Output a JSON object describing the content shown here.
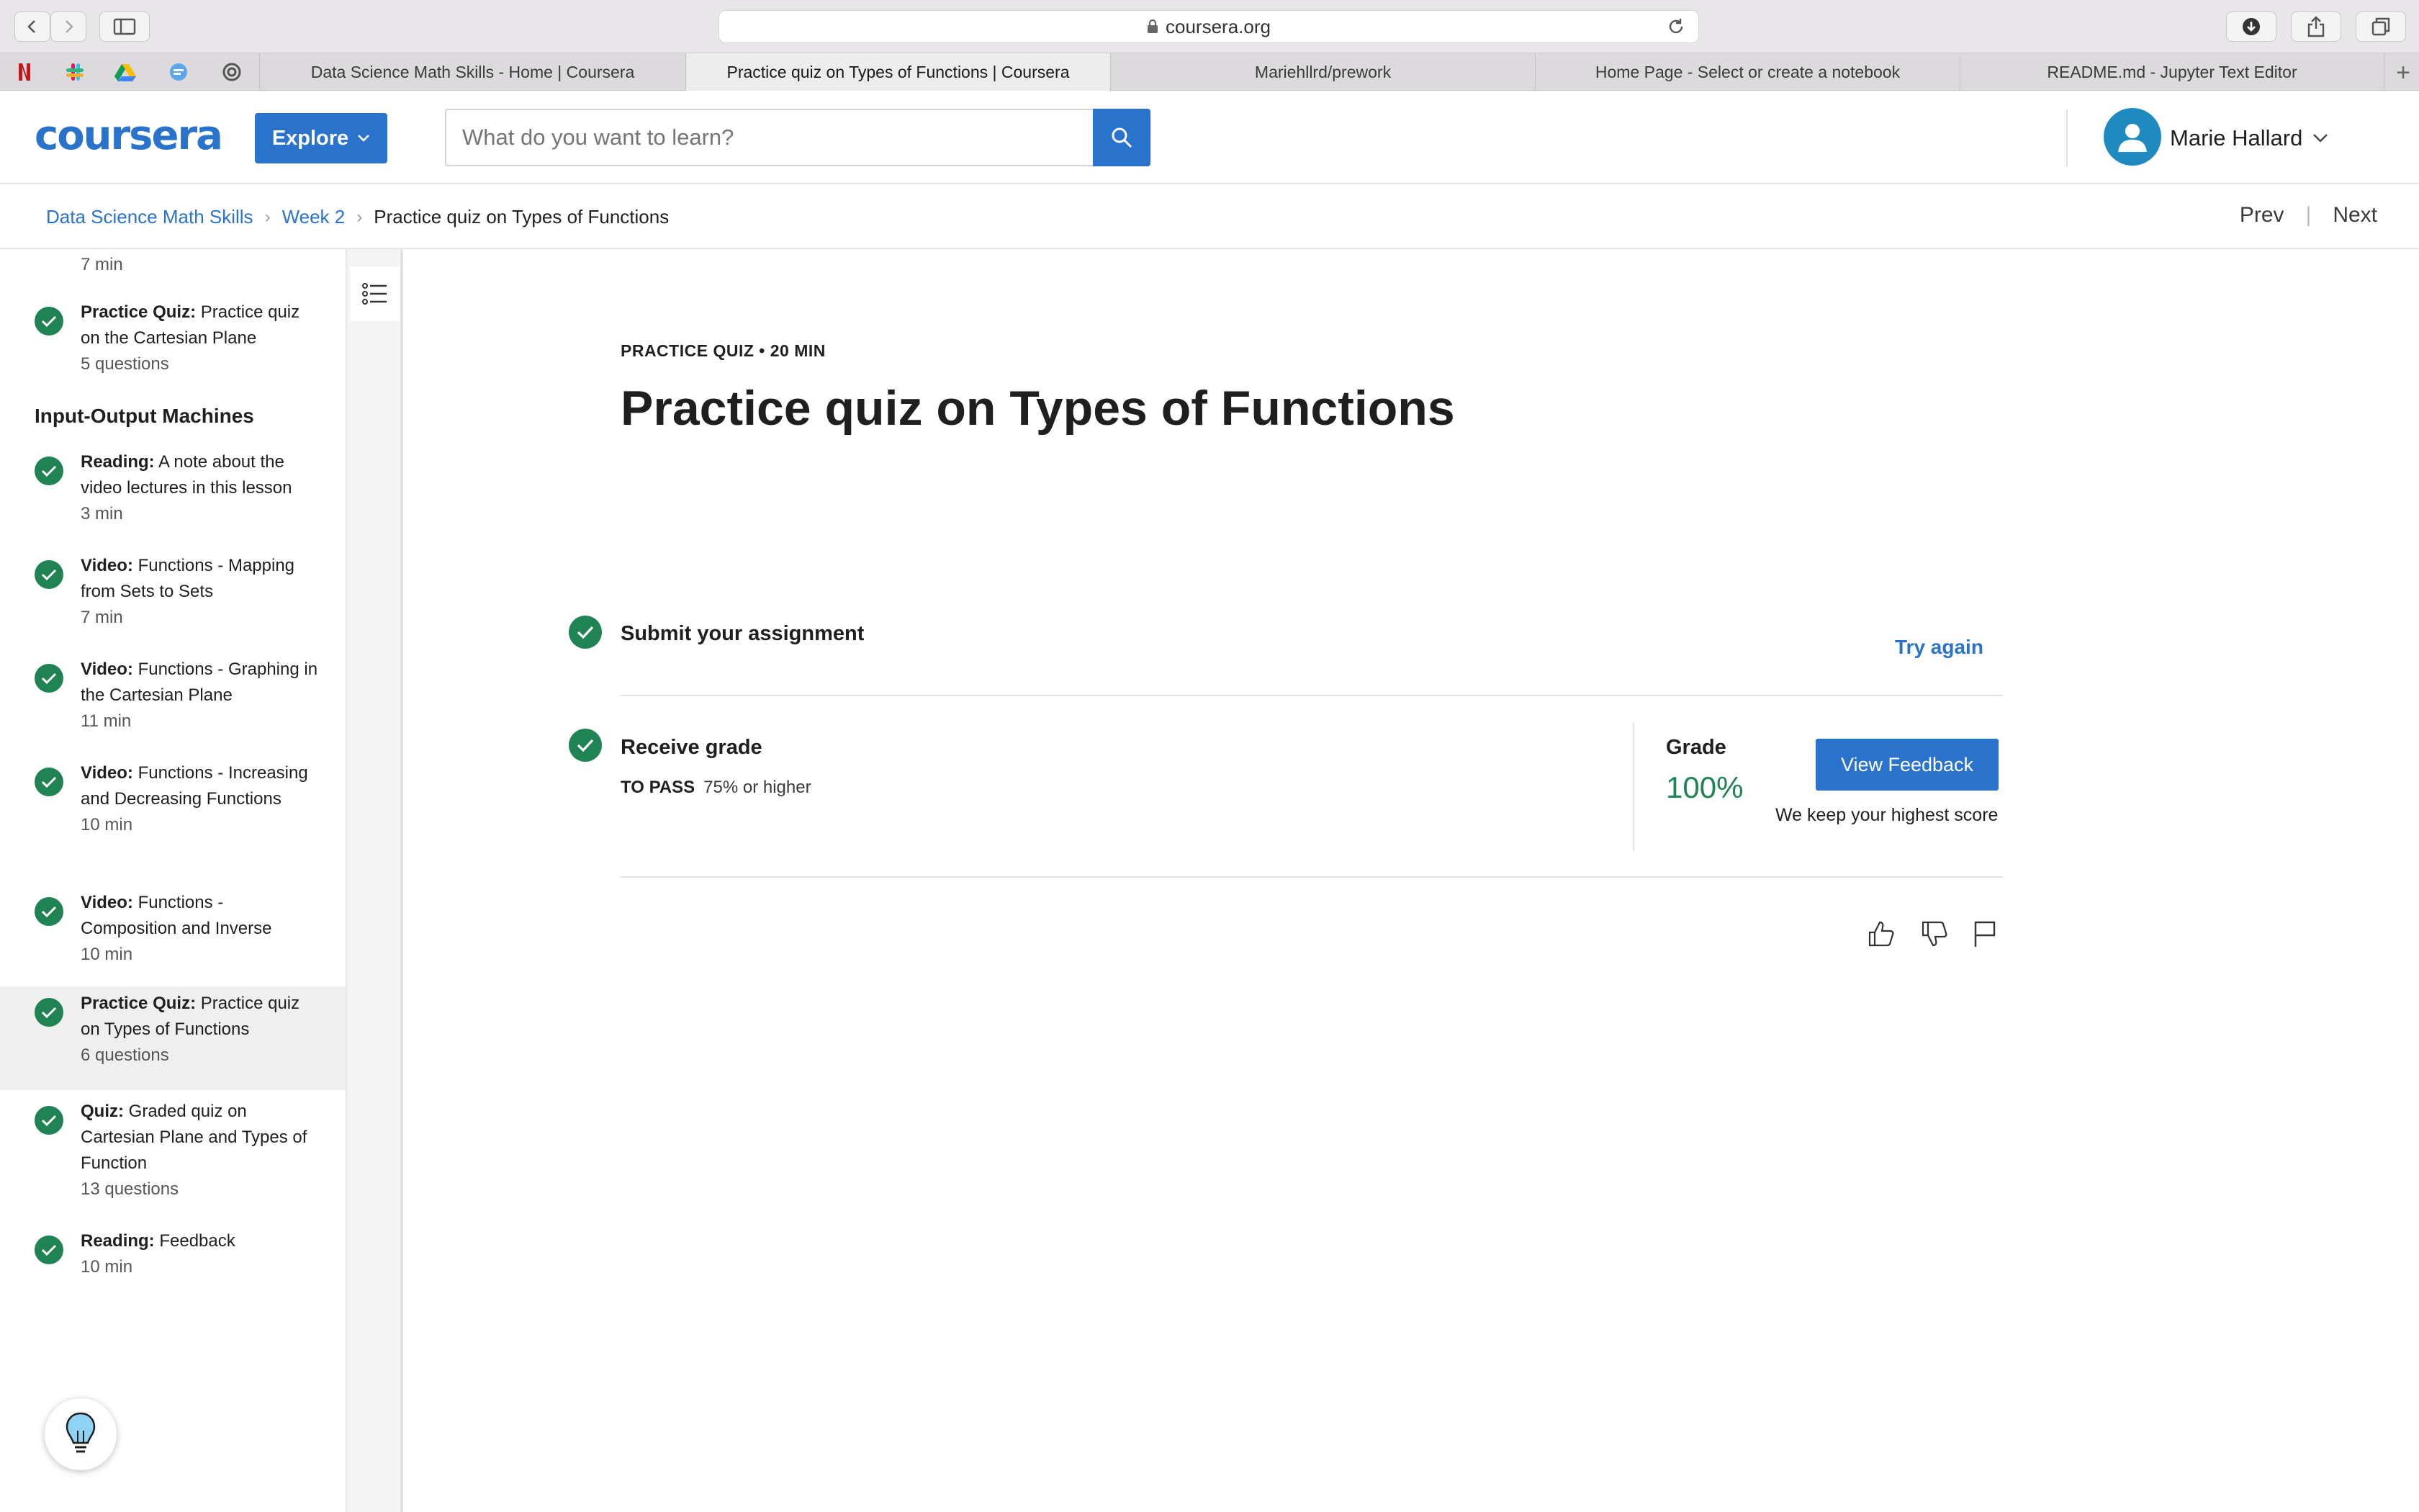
{
  "browser": {
    "url": "coursera.org",
    "tabs": [
      {
        "label": "Data Science Math Skills - Home | Coursera",
        "active": false
      },
      {
        "label": "Practice quiz on Types of Functions | Coursera",
        "active": true
      },
      {
        "label": "Mariehllrd/prework",
        "active": false
      },
      {
        "label": "Home Page - Select or create a notebook",
        "active": false
      },
      {
        "label": "README.md - Jupyter Text Editor",
        "active": false
      }
    ],
    "new_tab_label": "+"
  },
  "header": {
    "logo_text": "coursera",
    "explore_label": "Explore",
    "search_placeholder": "What do you want to learn?",
    "user_name": "Marie Hallard"
  },
  "breadcrumb": {
    "course": "Data Science Math Skills",
    "week": "Week 2",
    "current": "Practice quiz on Types of Functions",
    "prev_label": "Prev",
    "next_label": "Next"
  },
  "sidebar": {
    "top_meta": "7 min",
    "section_heading": "Input-Output Machines",
    "items": [
      {
        "type": "Practice Quiz:",
        "title": "Practice quiz on the Cartesian Plane",
        "meta": "5 questions"
      },
      {
        "type": "Reading:",
        "title": "A note about the video lectures in this lesson",
        "meta": "3 min"
      },
      {
        "type": "Video:",
        "title": "Functions - Mapping from Sets to Sets",
        "meta": "7 min"
      },
      {
        "type": "Video:",
        "title": "Functions - Graphing in the Cartesian Plane",
        "meta": "11 min"
      },
      {
        "type": "Video:",
        "title": "Functions - Increasing and Decreasing Functions",
        "meta": "10 min"
      },
      {
        "type": "Video:",
        "title": "Functions - Composition and Inverse",
        "meta": "10 min"
      },
      {
        "type": "Practice Quiz:",
        "title": "Practice quiz on Types of Functions",
        "meta": "6 questions"
      },
      {
        "type": "Quiz:",
        "title": "Graded quiz on Cartesian Plane and Types of Function",
        "meta": "13 questions"
      },
      {
        "type": "Reading:",
        "title": "Feedback",
        "meta": "10 min"
      }
    ]
  },
  "main": {
    "eyebrow": "PRACTICE QUIZ • 20 MIN",
    "title": "Practice quiz on Types of Functions",
    "submit": {
      "title": "Submit your assignment",
      "action": "Try again"
    },
    "receive": {
      "title": "Receive grade",
      "to_pass_label": "TO PASS",
      "to_pass_value": "75% or higher",
      "grade_label": "Grade",
      "grade_value": "100%",
      "feedback_button": "View Feedback",
      "note": "We keep your highest score"
    }
  },
  "colors": {
    "brand_blue": "#2a73cc",
    "success_green": "#1f8354"
  }
}
